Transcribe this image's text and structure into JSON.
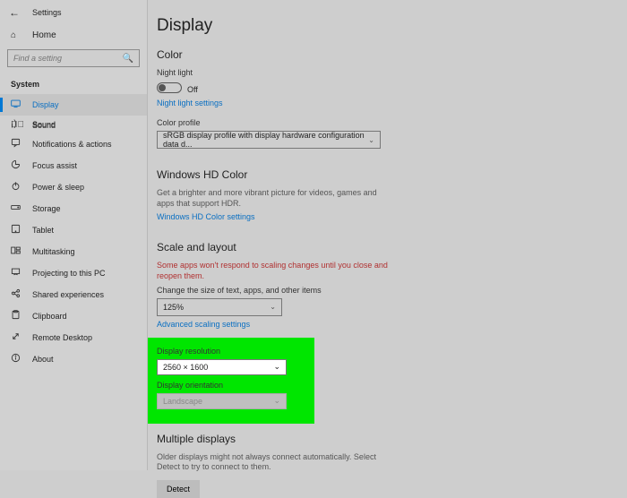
{
  "window": {
    "title": "Settings"
  },
  "sidebar": {
    "home": "Home",
    "search_placeholder": "Find a setting",
    "section": "System",
    "items": [
      {
        "label": "Display"
      },
      {
        "label": "Sound"
      },
      {
        "label": "Notifications & actions"
      },
      {
        "label": "Focus assist"
      },
      {
        "label": "Power & sleep"
      },
      {
        "label": "Storage"
      },
      {
        "label": "Tablet"
      },
      {
        "label": "Multitasking"
      },
      {
        "label": "Projecting to this PC"
      },
      {
        "label": "Shared experiences"
      },
      {
        "label": "Clipboard"
      },
      {
        "label": "Remote Desktop"
      },
      {
        "label": "About"
      }
    ]
  },
  "page": {
    "title": "Display",
    "color": {
      "heading": "Color",
      "night_light_label": "Night light",
      "night_light_state": "Off",
      "night_light_link": "Night light settings",
      "profile_label": "Color profile",
      "profile_value": "sRGB display profile with display hardware configuration data d..."
    },
    "hdcolor": {
      "heading": "Windows HD Color",
      "desc": "Get a brighter and more vibrant picture for videos, games and apps that support HDR.",
      "link": "Windows HD Color settings"
    },
    "scale": {
      "heading": "Scale and layout",
      "warn": "Some apps won't respond to scaling changes until you close and reopen them.",
      "change_label": "Change the size of text, apps, and other items",
      "scale_value": "125%",
      "adv_link": "Advanced scaling settings",
      "res_label": "Display resolution",
      "res_value": "2560 × 1600",
      "orient_label": "Display orientation",
      "orient_value": "Landscape"
    },
    "multi": {
      "heading": "Multiple displays",
      "desc": "Older displays might not always connect automatically. Select Detect to try to connect to them.",
      "detect": "Detect"
    }
  }
}
